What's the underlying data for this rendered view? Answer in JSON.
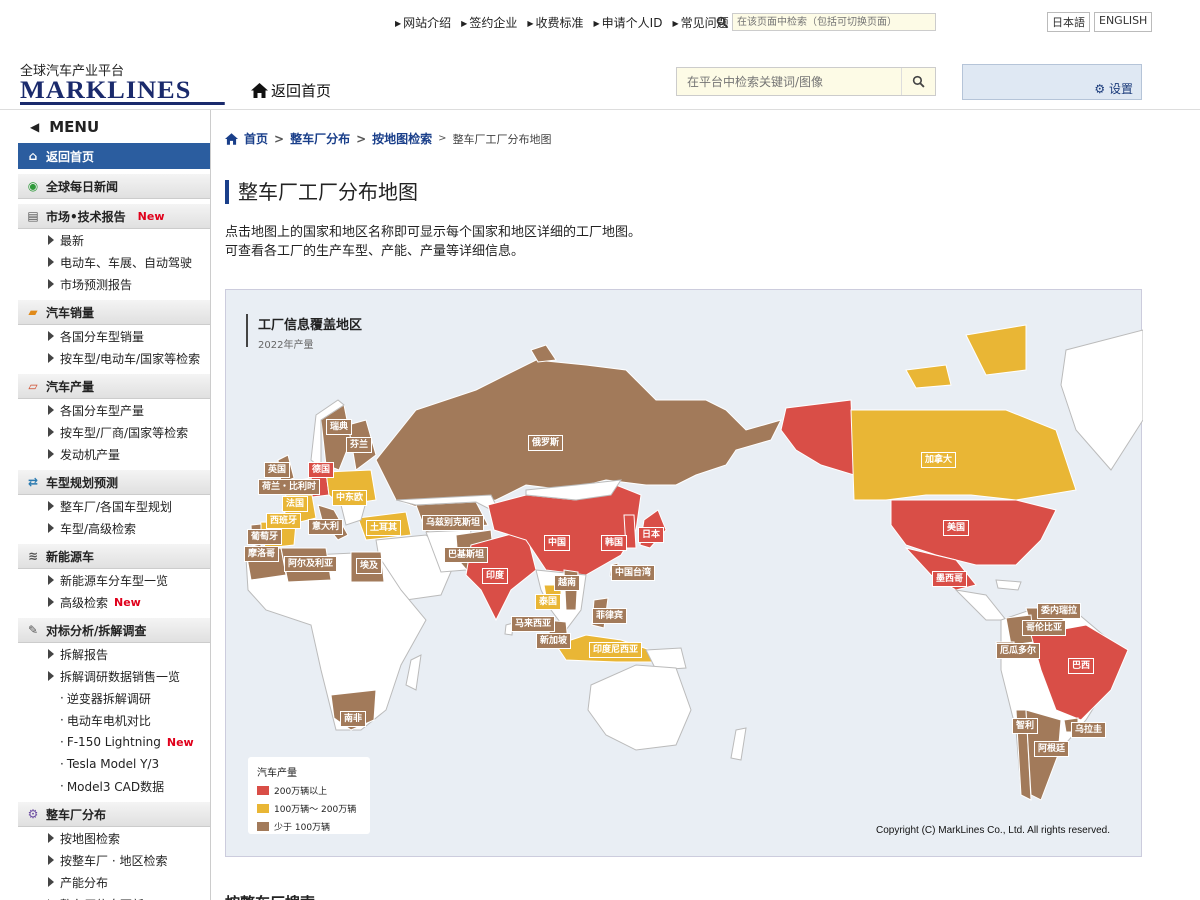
{
  "topnav": [
    "网站介绍",
    "签约企业",
    "收费标准",
    "申请个人ID",
    "常见问题"
  ],
  "top_search": {
    "placeholder": "在该页面中检索（包括可切换页面）"
  },
  "langs": [
    "日本語",
    "ENGLISH"
  ],
  "logo": {
    "line1": "全球汽车产业平台",
    "line2": "MARKLINES"
  },
  "home_label": "返回首页",
  "main_search": {
    "placeholder": "在平台中检索关键词/图像"
  },
  "settings_label": "设置",
  "sidebar": {
    "menu_label": "MENU",
    "sections": [
      {
        "label": "返回首页",
        "icon": "home-icon",
        "active": true,
        "items": []
      },
      {
        "label": "全球每日新闻",
        "icon": "camera-icon",
        "items": []
      },
      {
        "label": "市场•技术报告",
        "icon": "document-icon",
        "badge": "New",
        "items": [
          {
            "label": "最新"
          },
          {
            "label": "电动车、车展、自动驾驶"
          },
          {
            "label": "市场预测报告"
          }
        ]
      },
      {
        "label": "汽车销量",
        "icon": "folder-icon",
        "items": [
          {
            "label": "各国分车型销量"
          },
          {
            "label": "按车型/电动车/国家等检索"
          }
        ]
      },
      {
        "label": "汽车产量",
        "icon": "folder-open-icon",
        "items": [
          {
            "label": "各国分车型产量"
          },
          {
            "label": "按车型/厂商/国家等检索"
          },
          {
            "label": "发动机产量"
          }
        ]
      },
      {
        "label": "车型规划预测",
        "icon": "arrows-icon",
        "items": [
          {
            "label": "整车厂/各国车型规划"
          },
          {
            "label": "车型/高级检索"
          }
        ]
      },
      {
        "label": "新能源车",
        "icon": "wifi-icon",
        "items": [
          {
            "label": "新能源车分车型一览"
          },
          {
            "label": "高级检索",
            "badge": "New"
          }
        ]
      },
      {
        "label": "对标分析/拆解调查",
        "icon": "wrench-icon",
        "items": [
          {
            "label": "拆解报告"
          },
          {
            "label": "拆解调研数据销售一览"
          },
          {
            "label": "逆变器拆解调研",
            "sub": true
          },
          {
            "label": "电动车电机对比",
            "sub": true
          },
          {
            "label": "F-150 Lightning",
            "sub": true,
            "badge": "New"
          },
          {
            "label": "Tesla Model Y/3",
            "sub": true
          },
          {
            "label": "Model3 CAD数据",
            "sub": true
          }
        ]
      },
      {
        "label": "整车厂分布",
        "icon": "gear-icon",
        "items": [
          {
            "label": "按地图检索"
          },
          {
            "label": "按整车厂 · 地区检索"
          },
          {
            "label": "产能分布"
          },
          {
            "label": "整车厂信息更新"
          }
        ]
      }
    ]
  },
  "breadcrumb": {
    "home": "首页",
    "l2": "整车厂分布",
    "l3": "按地图检索",
    "current": "整车厂工厂分布地图"
  },
  "page_title": "整车厂工厂分布地图",
  "description": [
    "点击地图上的国家和地区名称即可显示每个国家和地区详细的工厂地图。",
    "可查看各工厂的生产车型、产能、产量等详细信息。"
  ],
  "map": {
    "title": "工厂信息覆盖地区",
    "subtitle": "2022年产量",
    "legend": {
      "title": "汽车产量",
      "items": [
        {
          "label": "200万辆以上",
          "color": "#d94e47"
        },
        {
          "label": "100万辆～ 200万辆",
          "color": "#e9b635"
        },
        {
          "label": "少于 100万辆",
          "color": "#a27a5a"
        }
      ]
    },
    "copyright": "Copyright (C) MarkLines Co., Ltd. All rights reserved.",
    "countries": [
      {
        "name": "瑞典",
        "level": "l"
      },
      {
        "name": "芬兰",
        "level": "l"
      },
      {
        "name": "俄罗斯",
        "level": "l"
      },
      {
        "name": "英国",
        "level": "l"
      },
      {
        "name": "德国",
        "level": "h"
      },
      {
        "name": "荷兰・比利时",
        "level": "l"
      },
      {
        "name": "中东欧",
        "level": "m"
      },
      {
        "name": "法国",
        "level": "m"
      },
      {
        "name": "西班牙",
        "level": "m"
      },
      {
        "name": "意大利",
        "level": "l"
      },
      {
        "name": "土耳其",
        "level": "m"
      },
      {
        "name": "乌兹别克斯坦",
        "level": "l"
      },
      {
        "name": "葡萄牙",
        "level": "l"
      },
      {
        "name": "摩洛哥",
        "level": "l"
      },
      {
        "name": "阿尔及利亚",
        "level": "l"
      },
      {
        "name": "埃及",
        "level": "l"
      },
      {
        "name": "巴基斯坦",
        "level": "l"
      },
      {
        "name": "中国",
        "level": "h"
      },
      {
        "name": "韩国",
        "level": "h"
      },
      {
        "name": "日本",
        "level": "h"
      },
      {
        "name": "印度",
        "level": "h"
      },
      {
        "name": "越南",
        "level": "l"
      },
      {
        "name": "中国台湾",
        "level": "l"
      },
      {
        "name": "泰国",
        "level": "m"
      },
      {
        "name": "菲律宾",
        "level": "l"
      },
      {
        "name": "马来西亚",
        "level": "l"
      },
      {
        "name": "新加坡",
        "level": "l"
      },
      {
        "name": "印度尼西亚",
        "level": "m"
      },
      {
        "name": "南非",
        "level": "l"
      },
      {
        "name": "加拿大",
        "level": "m"
      },
      {
        "name": "美国",
        "level": "h"
      },
      {
        "name": "墨西哥",
        "level": "h"
      },
      {
        "name": "委内瑞拉",
        "level": "l"
      },
      {
        "name": "哥伦比亚",
        "level": "l"
      },
      {
        "name": "厄瓜多尔",
        "level": "l"
      },
      {
        "name": "巴西",
        "level": "h"
      },
      {
        "name": "智利",
        "level": "l"
      },
      {
        "name": "乌拉圭",
        "level": "l"
      },
      {
        "name": "阿根廷",
        "level": "l"
      }
    ]
  },
  "bottom_heading": "按整车厂搜索"
}
